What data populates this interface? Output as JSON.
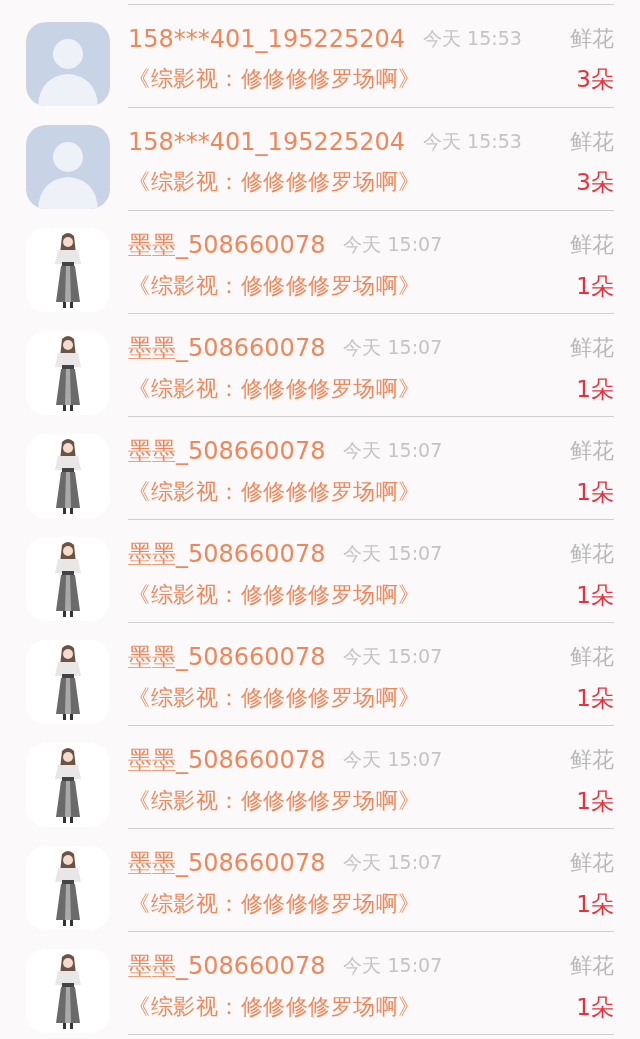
{
  "records": [
    {
      "avatar": {
        "kind": "silhouette"
      },
      "name": "158***401_195225204",
      "time": "今天 15:53",
      "gift": "鲜花",
      "title": "《综影视：修修修修罗场啊》",
      "count": "3朵"
    },
    {
      "avatar": {
        "kind": "silhouette"
      },
      "name": "158***401_195225204",
      "time": "今天 15:53",
      "gift": "鲜花",
      "title": "《综影视：修修修修罗场啊》",
      "count": "3朵"
    },
    {
      "name": "墨墨_508660078",
      "time": "今天 15:07",
      "gift": "鲜花",
      "title": "《综影视：修修修修罗场啊》",
      "count": "1朵"
    },
    {
      "name": "墨墨_508660078",
      "time": "今天 15:07",
      "gift": "鲜花",
      "title": "《综影视：修修修修罗场啊》",
      "count": "1朵"
    },
    {
      "name": "墨墨_508660078",
      "time": "今天 15:07",
      "gift": "鲜花",
      "title": "《综影视：修修修修罗场啊》",
      "count": "1朵"
    },
    {
      "name": "墨墨_508660078",
      "time": "今天 15:07",
      "gift": "鲜花",
      "title": "《综影视：修修修修罗场啊》",
      "count": "1朵"
    },
    {
      "name": "墨墨_508660078",
      "time": "今天 15:07",
      "gift": "鲜花",
      "title": "《综影视：修修修修罗场啊》",
      "count": "1朵"
    },
    {
      "name": "墨墨_508660078",
      "time": "今天 15:07",
      "gift": "鲜花",
      "title": "《综影视：修修修修罗场啊》",
      "count": "1朵"
    },
    {
      "name": "墨墨_508660078",
      "time": "今天 15:07",
      "gift": "鲜花",
      "title": "《综影视：修修修修罗场啊》",
      "count": "1朵"
    },
    {
      "name": "墨墨_508660078",
      "time": "今天 15:07",
      "gift": "鲜花",
      "title": "《综影视：修修修修罗场啊》",
      "count": "1朵"
    }
  ]
}
